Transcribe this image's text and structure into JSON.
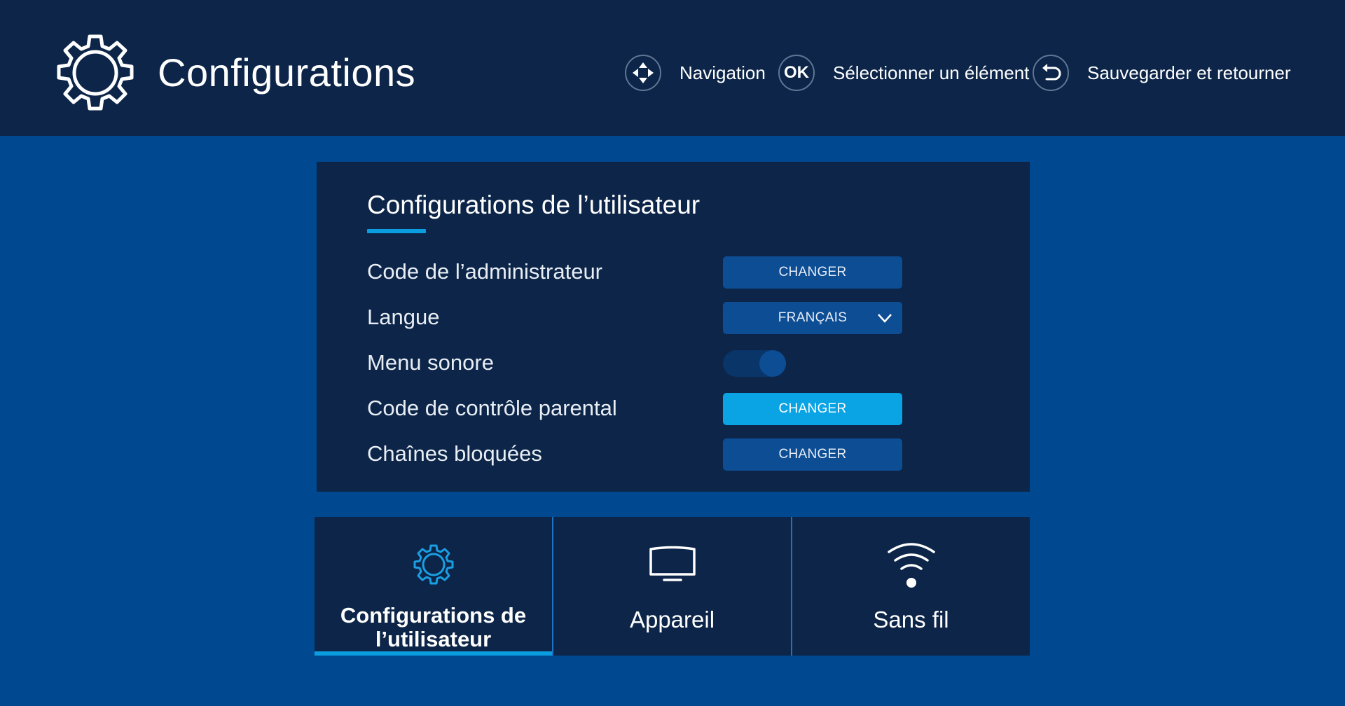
{
  "colors": {
    "background": "#004990",
    "header_bg": "#0c2548",
    "panel_bg": "#0c2548",
    "button_bg": "#0d4d94",
    "button_active_bg": "#0aa3e4",
    "accent": "#0a9ee0"
  },
  "header": {
    "icon": "gear-icon",
    "title": "Configurations",
    "hints": [
      {
        "icon": "dpad-icon",
        "label": "Navigation"
      },
      {
        "icon": "ok-button-icon",
        "key": "OK",
        "label": "Sélectionner un élément"
      },
      {
        "icon": "back-arrow-icon",
        "label": "Sauvegarder et retourner"
      }
    ]
  },
  "panel": {
    "title": "Configurations de l’utilisateur",
    "rows": [
      {
        "label": "Code de l’administrateur",
        "control": "button",
        "value": "CHANGER",
        "focused": false
      },
      {
        "label": "Langue",
        "control": "select",
        "value": "FRANÇAIS",
        "focused": false
      },
      {
        "label": "Menu sonore",
        "control": "toggle",
        "on": true
      },
      {
        "label": "Code de contrôle parental",
        "control": "button",
        "value": "CHANGER",
        "focused": true
      },
      {
        "label": "Chaînes bloquées",
        "control": "button",
        "value": "CHANGER",
        "focused": false
      }
    ]
  },
  "tabs": [
    {
      "icon": "gear-icon",
      "label_line1": "Configurations de",
      "label_line2": "l’utilisateur",
      "selected": true
    },
    {
      "icon": "tv-icon",
      "label": "Appareil",
      "selected": false
    },
    {
      "icon": "wifi-icon",
      "label": "Sans fil",
      "selected": false
    }
  ]
}
